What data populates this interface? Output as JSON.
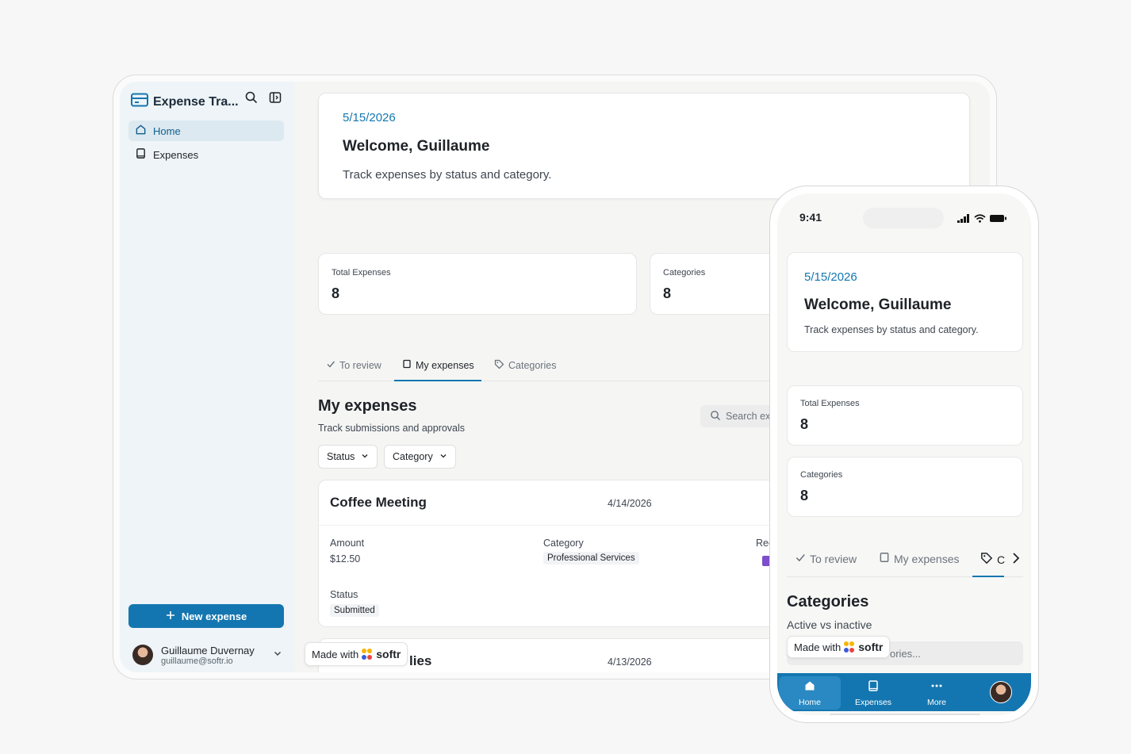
{
  "app": {
    "title": "Expense Tra...",
    "brand_color": "#1476b0"
  },
  "sidebar": {
    "items": [
      {
        "label": "Home",
        "icon": "home-icon",
        "active": true
      },
      {
        "label": "Expenses",
        "icon": "book-icon",
        "active": false
      }
    ],
    "new_button": "New expense",
    "user": {
      "name": "Guillaume Duvernay",
      "email": "guillaume@softr.io"
    }
  },
  "welcome": {
    "date": "5/15/2026",
    "title": "Welcome, Guillaume",
    "subtitle": "Track expenses by status and category."
  },
  "stats": [
    {
      "label": "Total Expenses",
      "value": "8"
    },
    {
      "label": "Categories",
      "value": "8"
    }
  ],
  "tabs": [
    {
      "label": "To review",
      "icon": "check-icon"
    },
    {
      "label": "My expenses",
      "icon": "book-icon",
      "active": true
    },
    {
      "label": "Categories",
      "icon": "tag-icon"
    }
  ],
  "section": {
    "title": "My expenses",
    "subtitle": "Track submissions and approvals",
    "search_placeholder": "Search exp"
  },
  "filters": {
    "status": "Status",
    "category": "Category"
  },
  "expenses": [
    {
      "title": "Coffee Meeting",
      "date": "4/14/2026",
      "amount_label": "Amount",
      "amount": "$12.50",
      "category_label": "Category",
      "category": "Professional Services",
      "receipt_label": "Rec",
      "status_label": "Status",
      "status": "Submitted"
    },
    {
      "title": "lies",
      "date": "4/13/2026"
    }
  ],
  "madewith": {
    "prefix": "Made with",
    "brand": "softr"
  },
  "phone": {
    "time": "9:41",
    "tabs": [
      {
        "label": "To review",
        "icon": "check-icon"
      },
      {
        "label": "My expenses",
        "icon": "book-icon"
      },
      {
        "label": "C",
        "icon": "tag-icon",
        "active": true
      }
    ],
    "section_title": "Categories",
    "section_subtitle": "Active vs inactive",
    "search_placeholder": "ories...",
    "bottom_nav": [
      {
        "label": "Home",
        "icon": "home-icon",
        "active": true
      },
      {
        "label": "Expenses",
        "icon": "book-icon"
      },
      {
        "label": "More",
        "icon": "more-icon"
      }
    ]
  }
}
